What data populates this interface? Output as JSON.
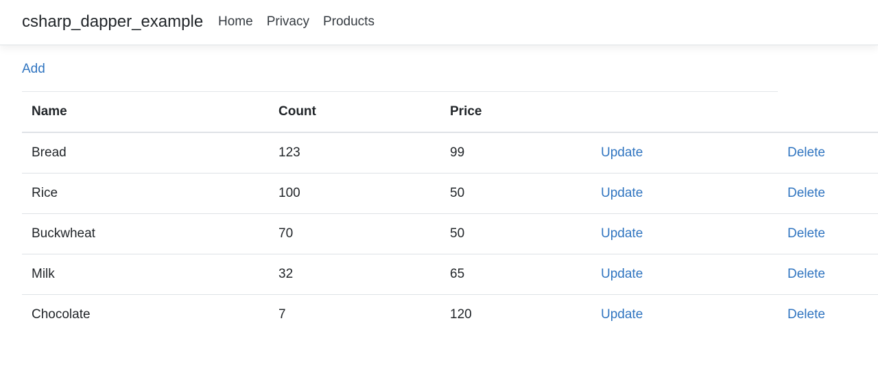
{
  "navbar": {
    "brand": "csharp_dapper_example",
    "links": [
      "Home",
      "Privacy",
      "Products"
    ]
  },
  "actions": {
    "add_label": "Add"
  },
  "table": {
    "headers": [
      "Name",
      "Count",
      "Price",
      "",
      ""
    ],
    "rows": [
      {
        "name": "Bread",
        "count": "123",
        "price": "99",
        "update": "Update",
        "delete": "Delete"
      },
      {
        "name": "Rice",
        "count": "100",
        "price": "50",
        "update": "Update",
        "delete": "Delete"
      },
      {
        "name": "Buckwheat",
        "count": "70",
        "price": "50",
        "update": "Update",
        "delete": "Delete"
      },
      {
        "name": "Milk",
        "count": "32",
        "price": "65",
        "update": "Update",
        "delete": "Delete"
      },
      {
        "name": "Chocolate",
        "count": "7",
        "price": "120",
        "update": "Update",
        "delete": "Delete"
      }
    ]
  },
  "colors": {
    "link": "#2f74c0",
    "text": "#212529",
    "border": "#dee2e6"
  }
}
